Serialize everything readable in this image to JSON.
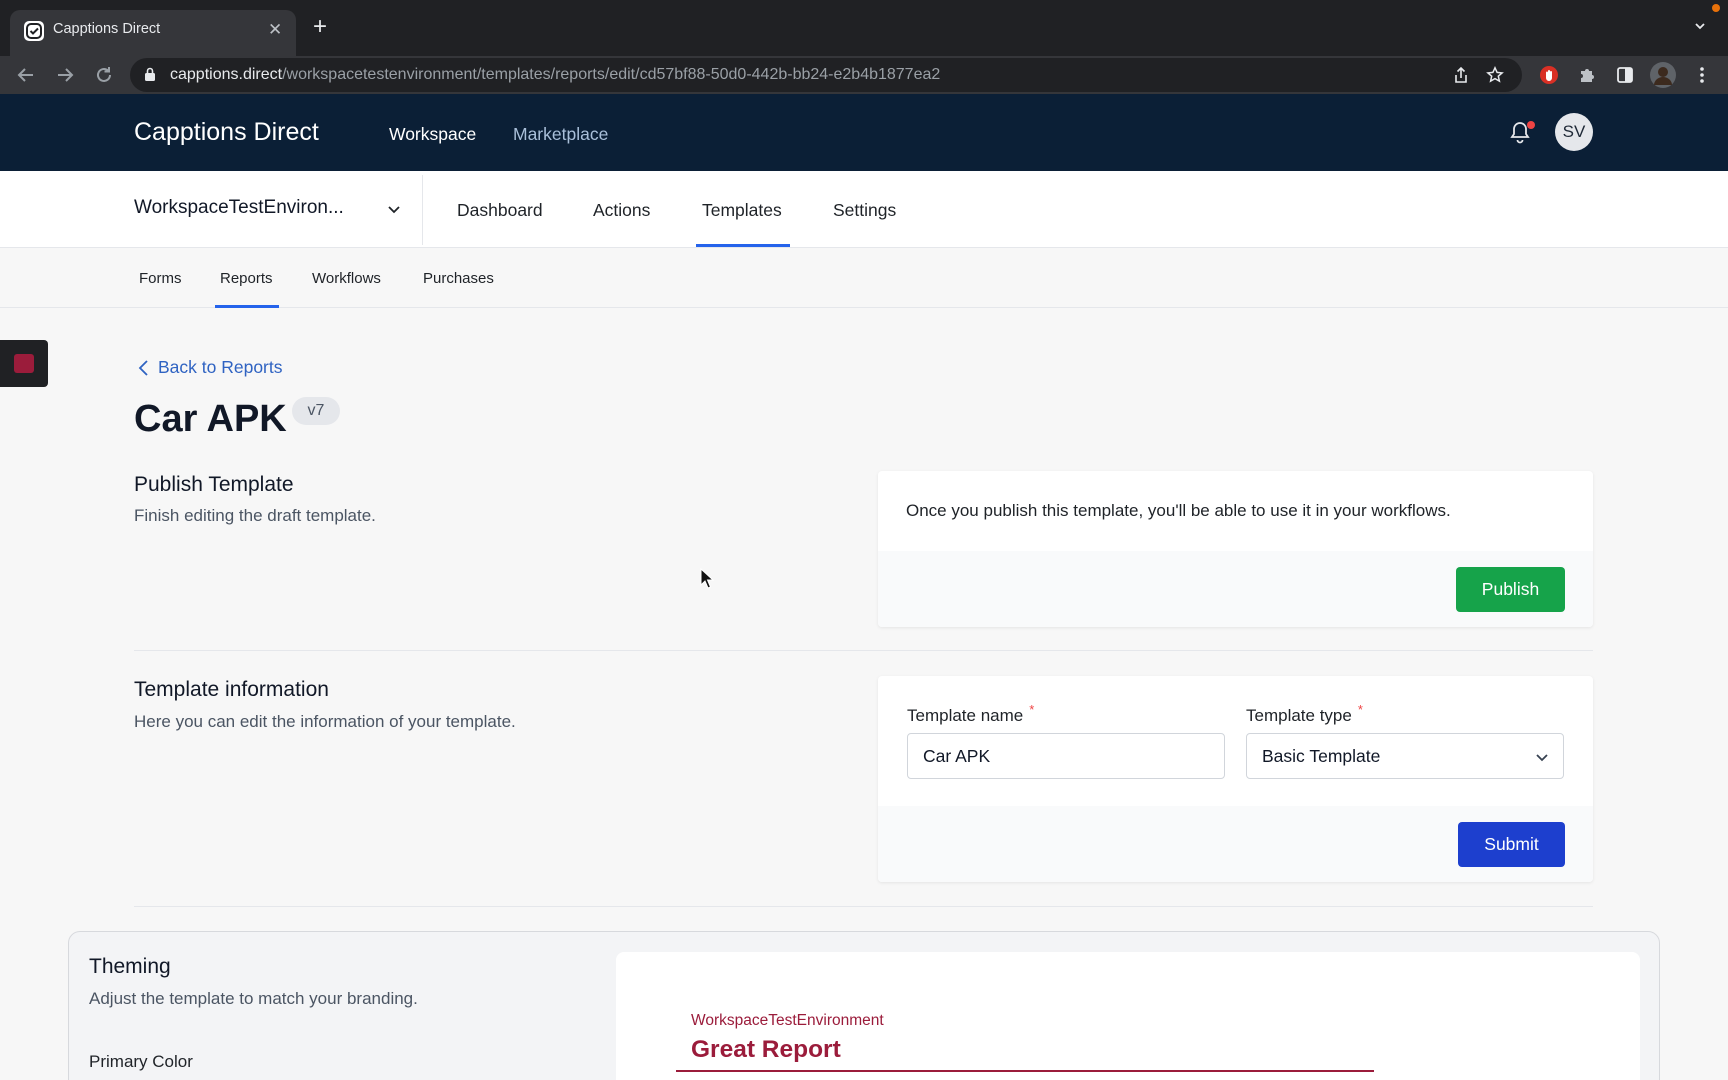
{
  "browser": {
    "tab_title": "Capptions Direct",
    "tab_close": "✕",
    "new_tab": "+",
    "url_host": "capptions.direct",
    "url_path": "/workspacetestenvironment/templates/reports/edit/cd57bf88-50d0-442b-bb24-e2b4b1877ea2"
  },
  "header": {
    "brand": "Capptions Direct",
    "nav": [
      "Workspace",
      "Marketplace"
    ],
    "active_nav": "Workspace",
    "avatar_initials": "SV",
    "has_notification": true
  },
  "workspace": {
    "name": "WorkspaceTestEnviron...",
    "tabs": [
      "Dashboard",
      "Actions",
      "Templates",
      "Settings"
    ],
    "active_tab": "Templates"
  },
  "subtabs": {
    "items": [
      "Forms",
      "Reports",
      "Workflows",
      "Purchases"
    ],
    "active": "Reports"
  },
  "page": {
    "back_label": "Back to Reports",
    "title": "Car APK",
    "version": "v7"
  },
  "publish": {
    "title": "Publish Template",
    "description": "Finish editing the draft template.",
    "message": "Once you publish this template, you'll be able to use it in your workflows.",
    "button": "Publish"
  },
  "template_info": {
    "title": "Template information",
    "description": "Here you can edit the information of your template.",
    "name_label": "Template name",
    "name_value": "Car APK",
    "type_label": "Template type",
    "type_value": "Basic Template",
    "required_mark": "*",
    "submit": "Submit"
  },
  "theming": {
    "title": "Theming",
    "description": "Adjust the template to match your branding.",
    "primary_color_label": "Primary Color",
    "preview_workspace": "WorkspaceTestEnvironment",
    "preview_title": "Great Report"
  },
  "colors": {
    "brand_navy": "#0b1f36",
    "accent_blue": "#2563eb",
    "publish_green": "#16a34a",
    "submit_blue": "#1d3fce",
    "theme_primary": "#9b1c3b"
  },
  "icons": [
    "favicon-icon",
    "close-icon",
    "plus-icon",
    "chevron-down-icon",
    "back-arrow-icon",
    "forward-arrow-icon",
    "reload-icon",
    "lock-icon",
    "share-icon",
    "star-icon",
    "extension-icon",
    "puzzle-icon",
    "sidepanel-icon",
    "profile-icon",
    "menu-icon",
    "bell-icon",
    "chevron-left-icon",
    "record-stop-icon",
    "cursor-icon"
  ]
}
